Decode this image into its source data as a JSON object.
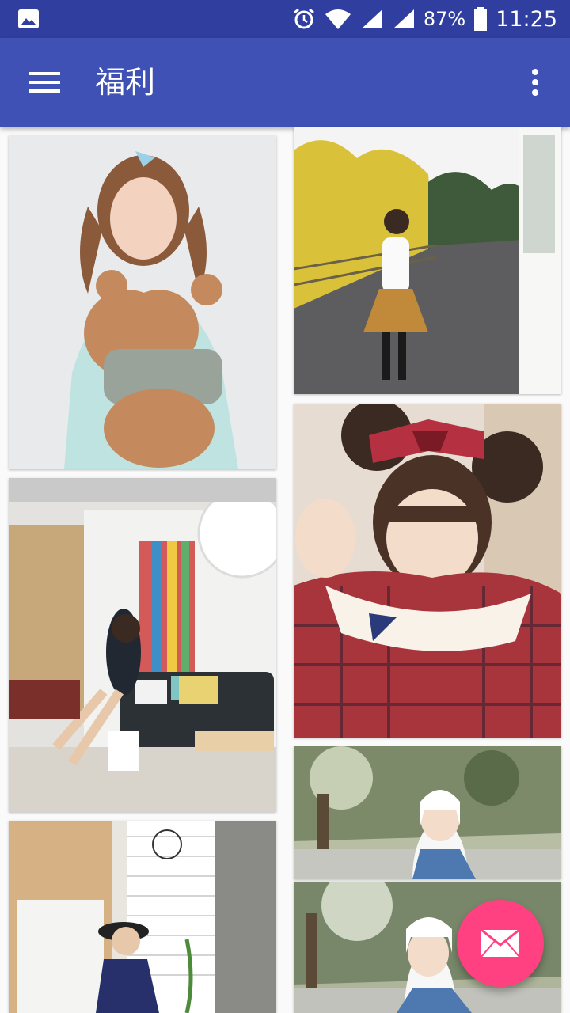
{
  "status_bar": {
    "battery": "87%",
    "time": "11:25",
    "icons": [
      "image-icon",
      "alarm-icon",
      "wifi-icon",
      "signal-icon",
      "battery-icon"
    ]
  },
  "app_bar": {
    "title": "福利",
    "menu_icon": "menu-icon",
    "overflow_icon": "more-vert-icon"
  },
  "gallery": {
    "photos": [
      {
        "description": "girl-with-teddy-bear"
      },
      {
        "description": "girl-in-yellow-skirt-outdoors"
      },
      {
        "description": "girl-in-living-room"
      },
      {
        "description": "girl-with-bear-ears-plaid-dress"
      },
      {
        "description": "girl-in-hood-forest"
      },
      {
        "description": "girl-smiling-forest"
      },
      {
        "description": "girl-in-hat-storefront"
      }
    ]
  },
  "fab": {
    "icon": "email-icon"
  },
  "colors": {
    "primary": "#3f51b5",
    "primary_dark": "#303f9f",
    "accent": "#ff4081"
  }
}
